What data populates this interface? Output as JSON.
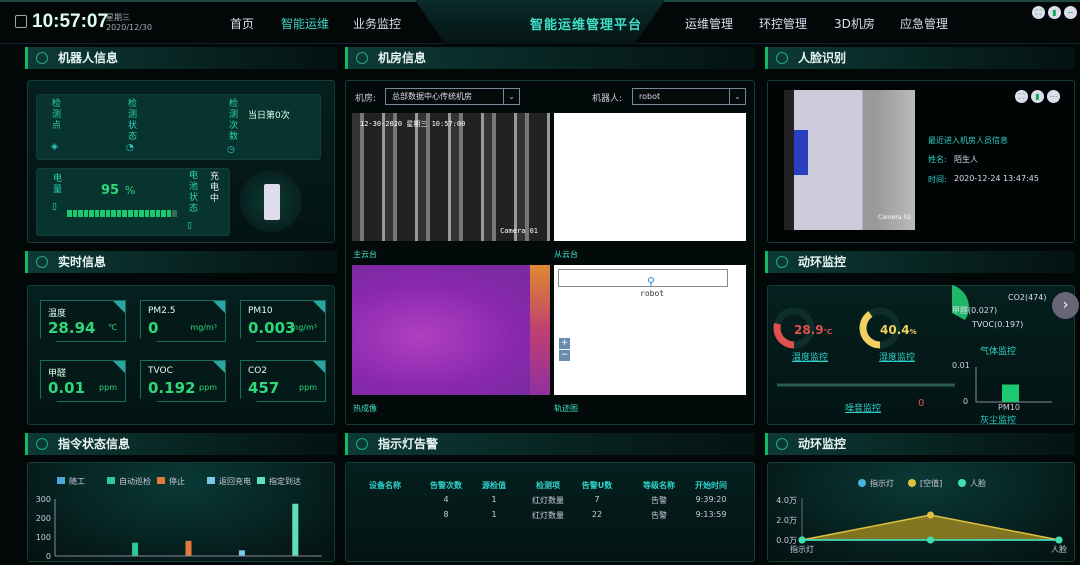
{
  "header": {
    "time": "10:57:07",
    "weekday": "星期三",
    "date": "2020/12/30",
    "title": "智能运维管理平台",
    "nav_left": [
      {
        "label": "首页",
        "active": false
      },
      {
        "label": "智能运维",
        "active": true
      },
      {
        "label": "业务监控",
        "active": false
      }
    ],
    "nav_right": [
      "运维管理",
      "环控管理",
      "3D机房",
      "应急管理"
    ],
    "icons": [
      "fullscreen-icon",
      "document-icon",
      "minus-circle-icon"
    ]
  },
  "robot_info": {
    "title": "机器人信息",
    "check_point": "检测点",
    "check_status": "检测状态",
    "check_count": "检测次数",
    "today_count": "当日第0次",
    "battery_label": "电量",
    "battery_value": "95",
    "battery_unit": "%",
    "battery_level": 0.95,
    "battery_status_label": "电池状态",
    "battery_status": "充电中"
  },
  "realtime": {
    "title": "实时信息",
    "cards": [
      {
        "label": "温度",
        "value": "28.94",
        "unit": "℃"
      },
      {
        "label": "PM2.5",
        "value": "0",
        "unit": "mg/m³"
      },
      {
        "label": "PM10",
        "value": "0.003",
        "unit": "mg/m³"
      },
      {
        "label": "甲醛",
        "value": "0.01",
        "unit": "ppm"
      },
      {
        "label": "TVOC",
        "value": "0.192",
        "unit": "ppm"
      },
      {
        "label": "CO2",
        "value": "457",
        "unit": "ppm"
      }
    ]
  },
  "room_info": {
    "title": "机房信息",
    "room_label": "机房:",
    "room_value": "总部数据中心传统机房",
    "robot_label": "机器人:",
    "robot_value": "robot",
    "cam_overlay": "12-30-2020 星期三 10:57:00",
    "cam_name": "Camera 01",
    "views": [
      "主云台",
      "从云台",
      "热成像",
      "轨迹图"
    ],
    "map_marker": "robot",
    "zoom_in": "+",
    "zoom_out": "−"
  },
  "face": {
    "title": "人脸识别",
    "heading": "最近进入机房人员信息",
    "name_label": "姓名:",
    "name": "陌生人",
    "time_label": "时间:",
    "time": "2020-12-24 13:47:45",
    "cam_name": "Camera 02"
  },
  "env": {
    "title": "动环监控",
    "temp": "28.9",
    "temp_unit": "℃",
    "temp_fraction": 0.29,
    "temp_label": "温度监控",
    "hum": "40.4",
    "hum_unit": "%",
    "hum_fraction": 0.404,
    "hum_label": "湿度监控",
    "noise_label": "噪音监控",
    "noise_value": "0",
    "gas_label": "气体监控",
    "gas": [
      "CO2(474)",
      "甲醛(0.027)",
      "TVOC(0.197)"
    ],
    "dust_label": "灰尘监控"
  },
  "alarm": {
    "title": "指示灯告警",
    "headers": [
      "设备名称",
      "告警次数",
      "源检值",
      "检测项",
      "告警U数",
      "等级名称",
      "开始时间"
    ],
    "rows": [
      [
        "",
        "4",
        "1",
        "红灯数量",
        "7",
        "告警",
        "9:39:20"
      ],
      [
        "",
        "8",
        "1",
        "红灯数量",
        "22",
        "告警",
        "9:13:59"
      ]
    ]
  },
  "command": {
    "title": "指令状态信息"
  },
  "env2": {
    "title": "动环监控"
  },
  "chart_data": [
    {
      "type": "bar",
      "title": "指令状态信息",
      "series": [
        {
          "name": "随工",
          "value": 2,
          "color": "#4aa8d8"
        },
        {
          "name": "自动巡检",
          "value": 70,
          "color": "#2fc898"
        },
        {
          "name": "停止",
          "value": 80,
          "color": "#e07a3a"
        },
        {
          "name": "返回充电",
          "value": 30,
          "color": "#7ac8e8"
        },
        {
          "name": "指定到达",
          "value": 275,
          "color": "#5ee0b8"
        }
      ],
      "yticks": [
        "0",
        "100",
        "200",
        "300"
      ],
      "ylim": [
        0,
        300
      ],
      "legend": "top"
    },
    {
      "type": "area",
      "title": "动环监控",
      "categories": [
        "指示灯",
        "",
        "人脸"
      ],
      "series": [
        {
          "name": "指示灯",
          "values": [
            0,
            0,
            0
          ],
          "color": "#4ab0e0"
        },
        {
          "name": "[空值]",
          "values": [
            0,
            25000,
            0
          ],
          "color": "#e0c040"
        },
        {
          "name": "人脸",
          "values": [
            0,
            0,
            0
          ],
          "color": "#40e0b0"
        }
      ],
      "yticks": [
        "0.0万",
        "2.0万",
        "4.0万"
      ],
      "ylim": [
        0,
        40000
      ],
      "legend": "top"
    },
    {
      "type": "bar",
      "title": "灰尘监控",
      "categories": [
        "PM10"
      ],
      "values": [
        0.005
      ],
      "yticks": [
        "0",
        "0.01"
      ],
      "ylim": [
        0,
        0.01
      ]
    }
  ]
}
